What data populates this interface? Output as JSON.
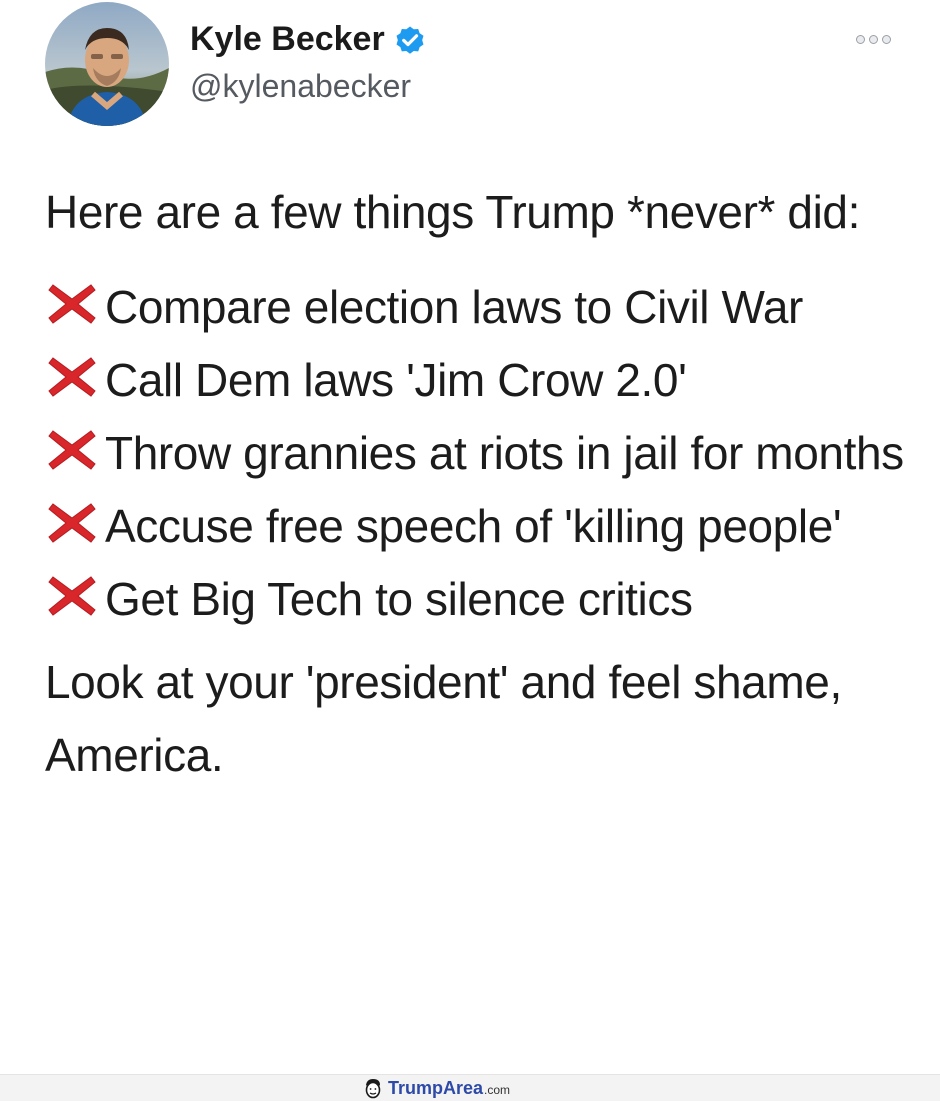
{
  "tweet": {
    "author_name": "Kyle Becker",
    "author_handle": "@kylenabecker",
    "verified": true,
    "intro": "Here are a few things Trump *never* did:",
    "items": [
      "Compare election laws to Civil War",
      "Call Dem laws 'Jim Crow 2.0'",
      "Throw grannies at riots in jail for months",
      "Accuse free speech of 'killing people'",
      "Get Big Tech to silence critics"
    ],
    "closing": "Look at your 'president' and feel shame, America."
  },
  "icons": {
    "verified": "verified-badge-icon",
    "more": "more-options-icon",
    "item_marker": "red-x-icon",
    "watermark": "face-logo-icon"
  },
  "colors": {
    "verified_blue": "#1d9bf0",
    "x_red": "#d9262a",
    "brand_blue": "#2e4aa8"
  },
  "watermark": {
    "name": "TrumpArea",
    "tld": ".com"
  }
}
